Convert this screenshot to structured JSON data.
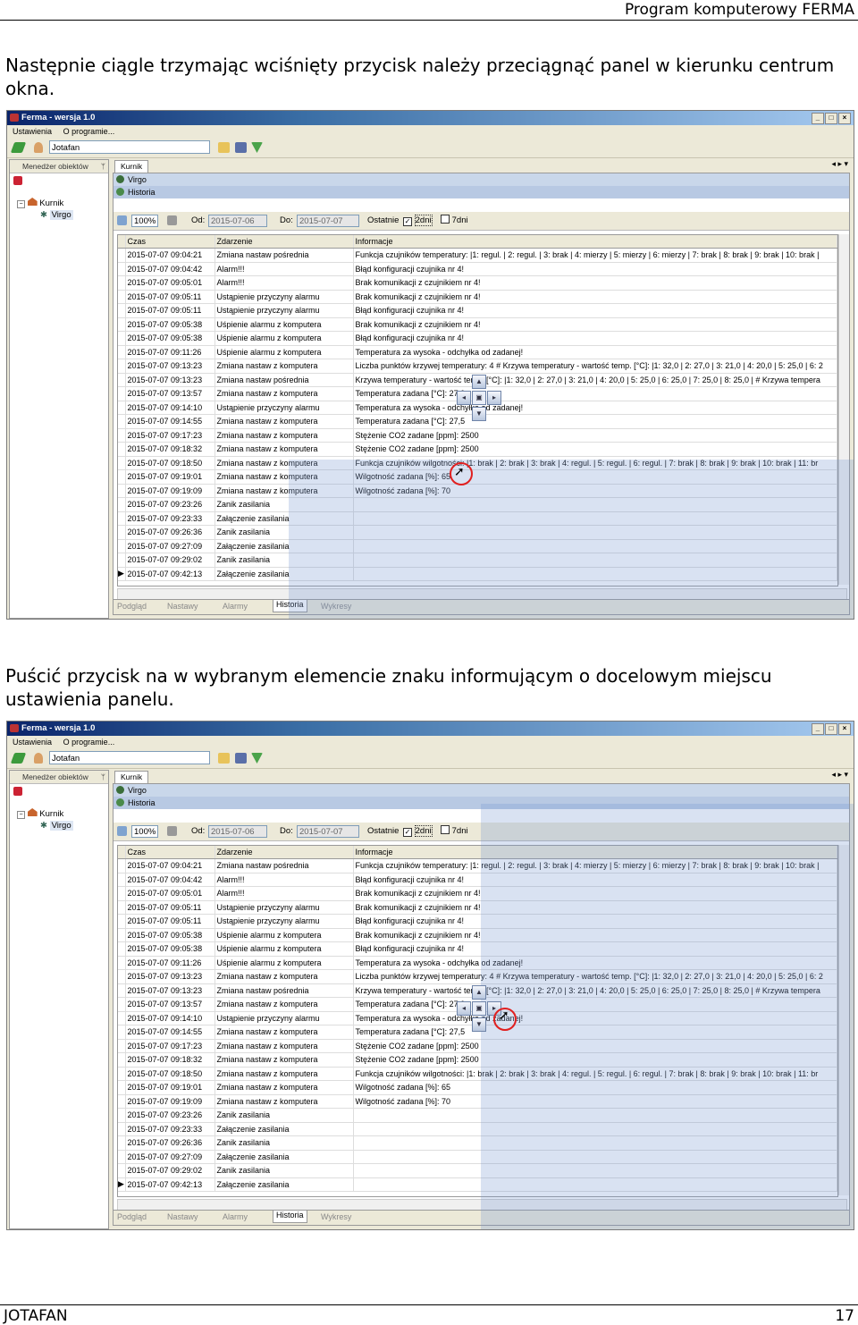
{
  "header": {
    "title": "Program komputerowy FERMA"
  },
  "paragraphs": {
    "p1": "Następnie ciągle trzymając wciśnięty przycisk należy przeciągnąć panel w kierunku centrum okna.",
    "p2": "Puścić przycisk na w wybranym elemencie znaku informującym o docelowym miejscu ustawienia panelu."
  },
  "footer": {
    "left": "JOTAFAN",
    "right": "17"
  },
  "app": {
    "title": "Ferma - wersja 1.0",
    "menu": [
      "Ustawienia",
      "O programie..."
    ],
    "user": "Jotafan",
    "left_panel_title": "Menedżer obiektów",
    "tree": {
      "root": "Kurnik",
      "child": "Virgo"
    },
    "doc_tab": "Kurnik",
    "band1": "Virgo",
    "band2": "Historia",
    "filter": {
      "zoom": "100%",
      "from_label": "Od:",
      "from_value": "2015-07-06",
      "to_label": "Do:",
      "to_value": "2015-07-07",
      "recent_label": "Ostatnie",
      "opt_2days": "2dni",
      "opt_7days": "7dni"
    },
    "columns": [
      "Czas",
      "Zdarzenie",
      "Informacje"
    ],
    "rows": [
      [
        "2015-07-07 09:04:21",
        "Zmiana nastaw pośrednia",
        "Funkcja czujników temperatury: |1: regul. | 2: regul. | 3: brak | 4: mierzy | 5: mierzy | 6: mierzy | 7: brak | 8: brak | 9: brak | 10: brak |"
      ],
      [
        "2015-07-07 09:04:42",
        "Alarm!!!",
        "Błąd konfiguracji czujnika nr 4!"
      ],
      [
        "2015-07-07 09:05:01",
        "Alarm!!!",
        "Brak komunikacji z czujnikiem nr 4!"
      ],
      [
        "2015-07-07 09:05:11",
        "Ustąpienie przyczyny alarmu",
        "Brak komunikacji z czujnikiem nr 4!"
      ],
      [
        "2015-07-07 09:05:11",
        "Ustąpienie przyczyny alarmu",
        "Błąd konfiguracji czujnika nr 4!"
      ],
      [
        "2015-07-07 09:05:38",
        "Uśpienie alarmu z komputera",
        "Brak komunikacji z czujnikiem nr 4!"
      ],
      [
        "2015-07-07 09:05:38",
        "Uśpienie alarmu z komputera",
        "Błąd konfiguracji czujnika nr 4!"
      ],
      [
        "2015-07-07 09:11:26",
        "Uśpienie alarmu z komputera",
        "Temperatura za wysoka - odchyłka od zadanej!"
      ],
      [
        "2015-07-07 09:13:23",
        "Zmiana nastaw z komputera",
        "Liczba punktów krzywej temperatury: 4 # Krzywa temperatury - wartość temp. [°C]: |1: 32,0 | 2: 27,0 | 3: 21,0 | 4: 20,0 | 5: 25,0 | 6: 2"
      ],
      [
        "2015-07-07 09:13:23",
        "Zmiana nastaw pośrednia",
        "Krzywa temperatury - wartość temp. [°C]: |1: 32,0 | 2: 27,0 | 3: 21,0 | 4: 20,0 | 5: 25,0 | 6: 25,0 | 7: 25,0 | 8: 25,0 | # Krzywa tempera"
      ],
      [
        "2015-07-07 09:13:57",
        "Zmiana nastaw z komputera",
        "Temperatura zadana [°C]: 27,0"
      ],
      [
        "2015-07-07 09:14:10",
        "Ustąpienie przyczyny alarmu",
        "Temperatura za wysoka - odchyłka od zadanej!"
      ],
      [
        "2015-07-07 09:14:55",
        "Zmiana nastaw z komputera",
        "Temperatura zadana [°C]: 27,5"
      ],
      [
        "2015-07-07 09:17:23",
        "Zmiana nastaw z komputera",
        "Stężenie CO2 zadane [ppm]: 2500"
      ],
      [
        "2015-07-07 09:18:32",
        "Zmiana nastaw z komputera",
        "Stężenie CO2 zadane [ppm]: 2500"
      ],
      [
        "2015-07-07 09:18:50",
        "Zmiana nastaw z komputera",
        "Funkcja czujników wilgotności: |1: brak | 2: brak | 3: brak | 4: regul. | 5: regul. | 6: regul. | 7: brak | 8: brak | 9: brak | 10: brak | 11: br"
      ],
      [
        "2015-07-07 09:19:01",
        "Zmiana nastaw z komputera",
        "Wilgotność zadana [%]: 65"
      ],
      [
        "2015-07-07 09:19:09",
        "Zmiana nastaw z komputera",
        "Wilgotność zadana [%]: 70"
      ],
      [
        "2015-07-07 09:23:26",
        "Zanik zasilania",
        ""
      ],
      [
        "2015-07-07 09:23:33",
        "Załączenie zasilania",
        ""
      ],
      [
        "2015-07-07 09:26:36",
        "Zanik zasilania",
        ""
      ],
      [
        "2015-07-07 09:27:09",
        "Załączenie zasilania",
        ""
      ],
      [
        "2015-07-07 09:29:02",
        "Zanik zasilania",
        ""
      ],
      [
        "2015-07-07 09:42:13",
        "Załączenie zasilania",
        ""
      ]
    ],
    "bottom_tabs": [
      "Podgląd",
      "Nastawy",
      "Alarmy",
      "Historia",
      "Wykresy"
    ]
  },
  "colors": {
    "titlebar": "#0a246a",
    "band": "#c9d7ea",
    "overlay": "#7896d2",
    "cursor_ring": "#e02020"
  }
}
